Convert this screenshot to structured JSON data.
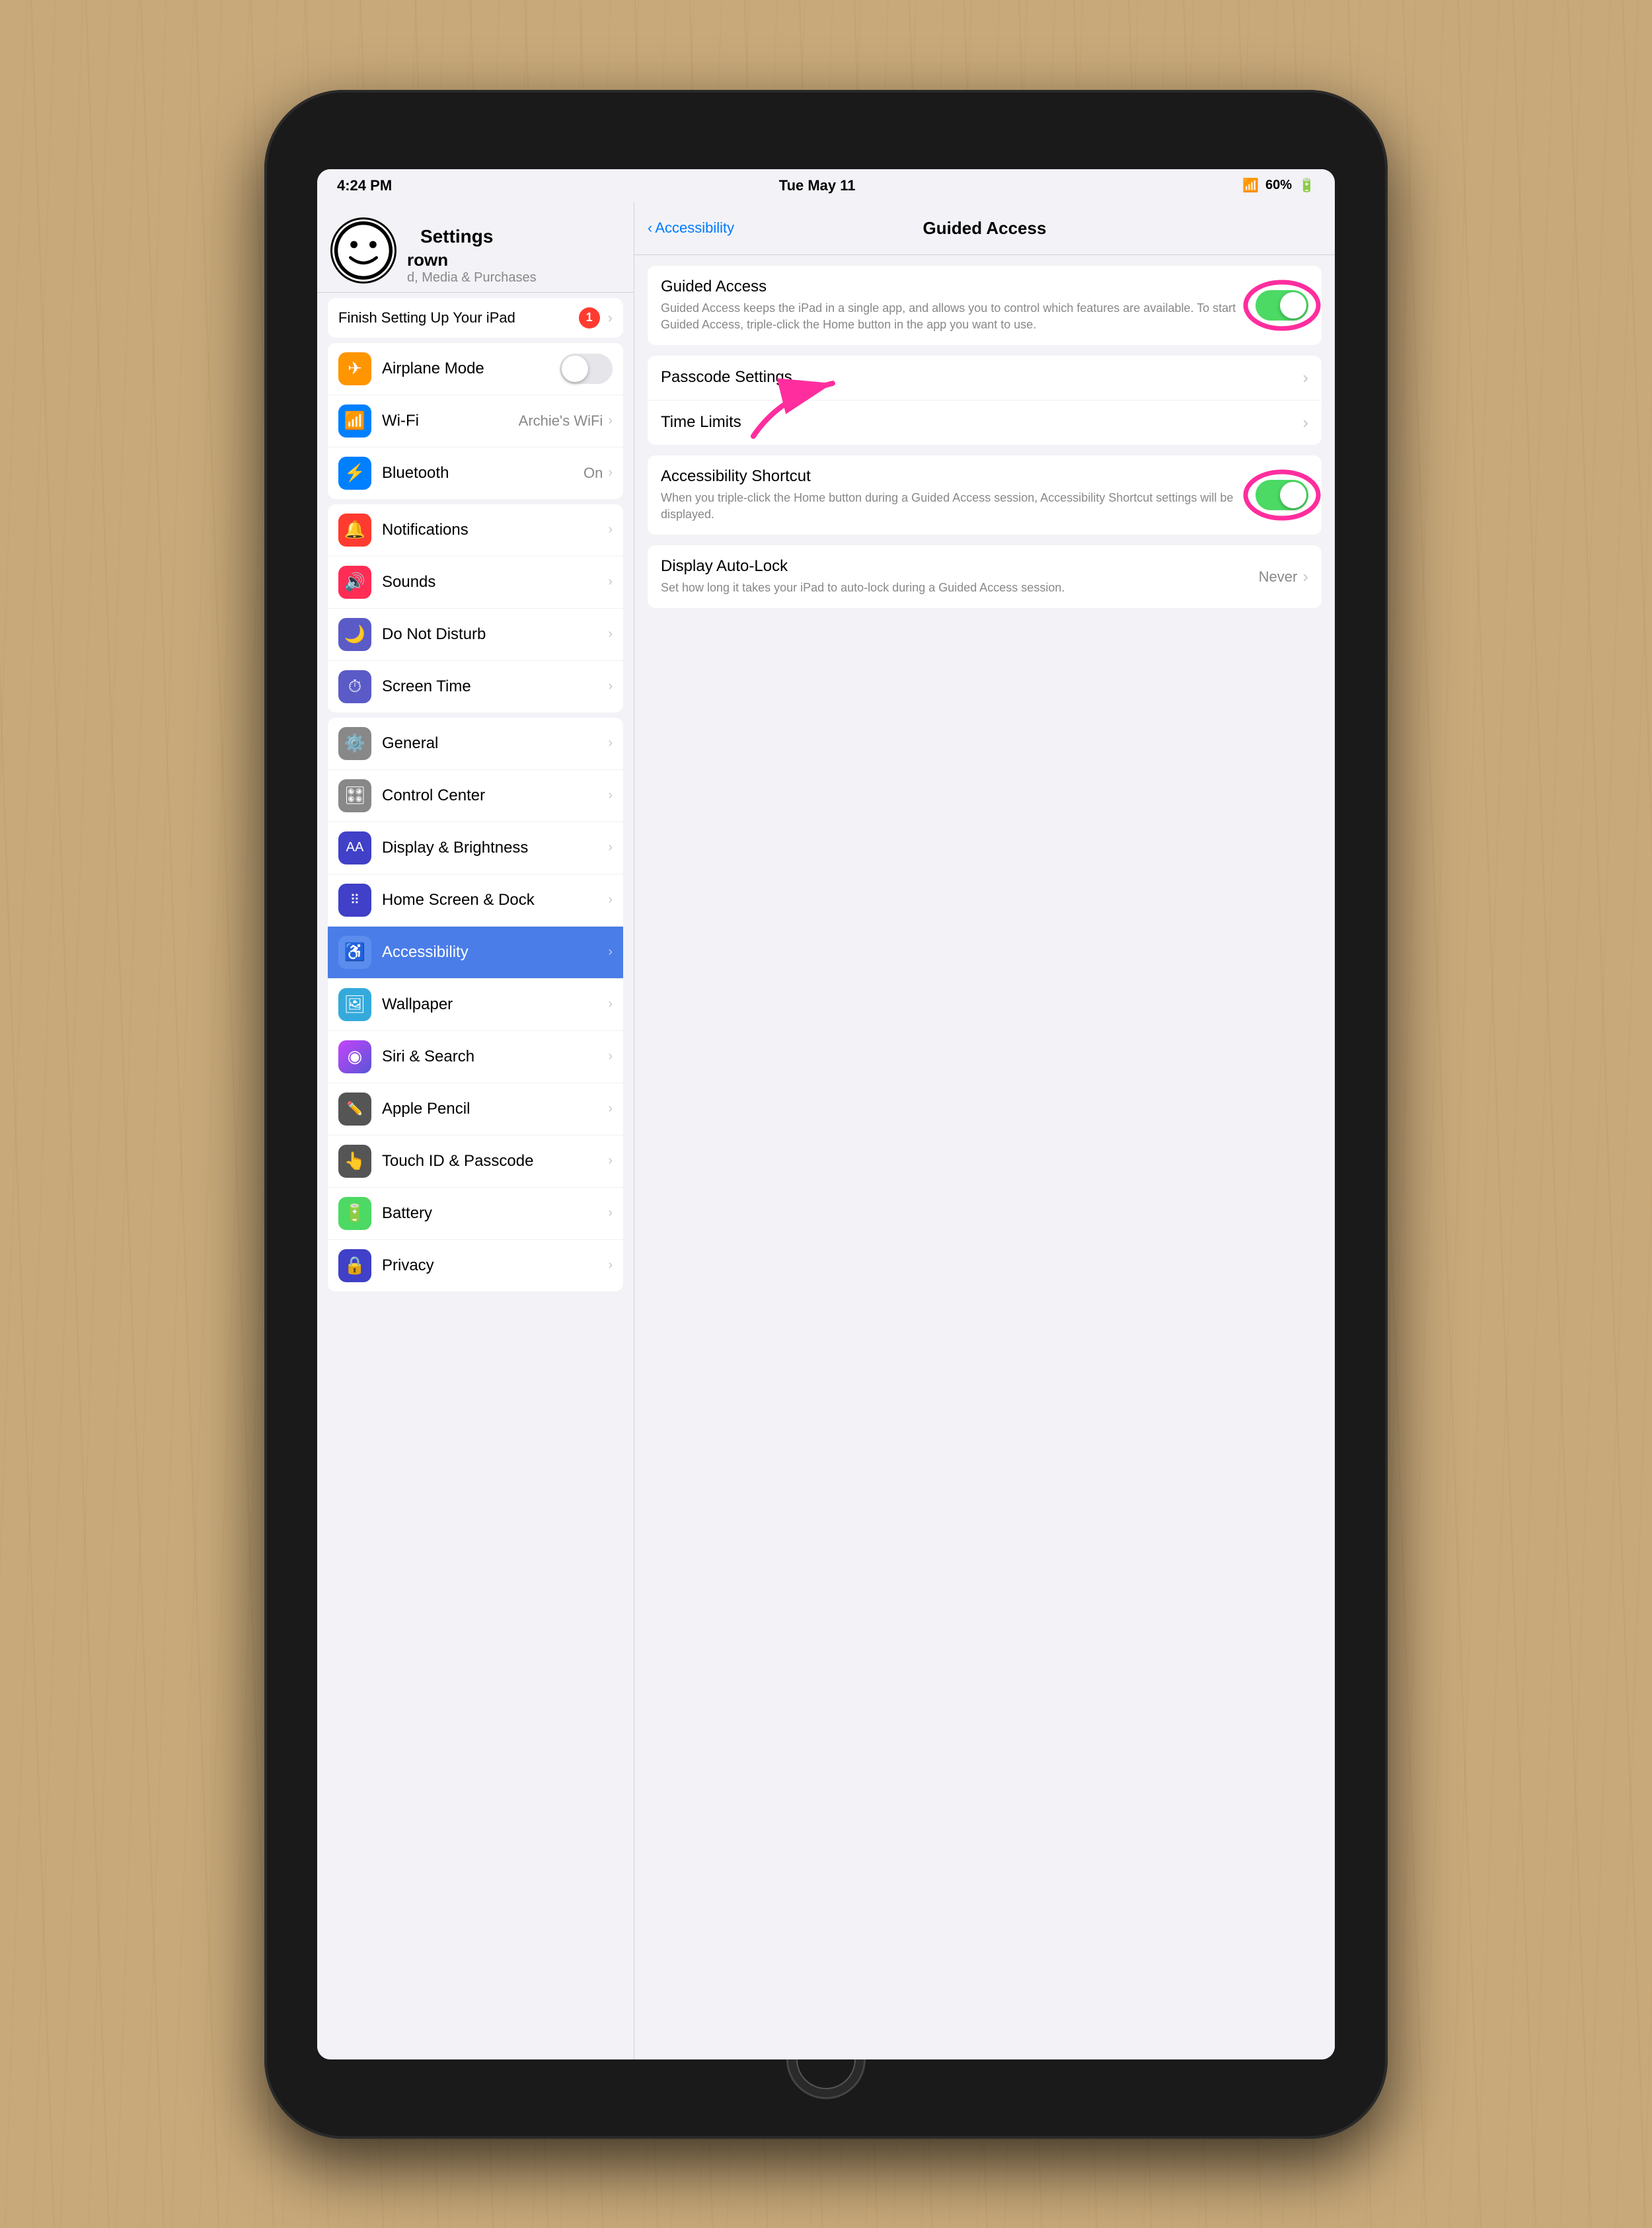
{
  "status_bar": {
    "time": "4:24 PM",
    "date": "Tue May 11",
    "battery": "60%",
    "wifi_icon": "wifi",
    "battery_icon": "battery"
  },
  "sidebar": {
    "title": "Settings",
    "profile": {
      "name": "rown",
      "subtitle": "d, Media & Purchases"
    },
    "setup_banner": {
      "text": "Finish Setting Up Your iPad",
      "badge": "1"
    },
    "groups": [
      {
        "items": [
          {
            "id": "airplane",
            "label": "Airplane Mode",
            "icon_color": "ic-airplane",
            "value": "",
            "toggle": "off",
            "has_toggle": true
          },
          {
            "id": "wifi",
            "label": "Wi-Fi",
            "icon_color": "ic-wifi",
            "value": "Archie's WiFi",
            "has_chevron": true
          },
          {
            "id": "bluetooth",
            "label": "Bluetooth",
            "icon_color": "ic-bluetooth",
            "value": "On",
            "has_chevron": true
          }
        ]
      },
      {
        "items": [
          {
            "id": "notifications",
            "label": "Notifications",
            "icon_color": "ic-notifications"
          },
          {
            "id": "sounds",
            "label": "Sounds",
            "icon_color": "ic-sounds"
          },
          {
            "id": "dnd",
            "label": "Do Not Disturb",
            "icon_color": "ic-dnd"
          },
          {
            "id": "screentime",
            "label": "Screen Time",
            "icon_color": "ic-screentime"
          }
        ]
      },
      {
        "items": [
          {
            "id": "general",
            "label": "General",
            "icon_color": "ic-general"
          },
          {
            "id": "controlcenter",
            "label": "Control Center",
            "icon_color": "ic-controlcenter"
          },
          {
            "id": "displaybright",
            "label": "Display & Brightness",
            "icon_color": "ic-displaybright"
          },
          {
            "id": "homescreen",
            "label": "Home Screen & Dock",
            "icon_color": "ic-homescreen"
          },
          {
            "id": "accessibility",
            "label": "Accessibility",
            "icon_color": "ic-accessibility",
            "active": true
          },
          {
            "id": "wallpaper",
            "label": "Wallpaper",
            "icon_color": "ic-wallpaper"
          },
          {
            "id": "siri",
            "label": "Siri & Search",
            "icon_color": "ic-siri"
          },
          {
            "id": "applepencil",
            "label": "Apple Pencil",
            "icon_color": "ic-applepencil"
          },
          {
            "id": "touchid",
            "label": "Touch ID & Passcode",
            "icon_color": "ic-touchid"
          },
          {
            "id": "battery",
            "label": "Battery",
            "icon_color": "ic-battery"
          },
          {
            "id": "privacy",
            "label": "Privacy",
            "icon_color": "ic-privacy"
          }
        ]
      }
    ]
  },
  "detail": {
    "nav_back": "Accessibility",
    "nav_title": "Guided Access",
    "sections": [
      {
        "rows": [
          {
            "id": "guided-access",
            "title": "Guided Access",
            "desc": "Guided Access keeps the iPad in a single app, and allows you to control which features are available. To start Guided Access, triple-click the Home button in the app you want to use.",
            "toggle": "on",
            "has_toggle": true
          }
        ]
      },
      {
        "rows": [
          {
            "id": "passcode-settings",
            "title": "Passcode Settings",
            "has_chevron": true
          },
          {
            "id": "time-limits",
            "title": "Time Limits",
            "has_chevron": true
          }
        ]
      },
      {
        "rows": [
          {
            "id": "accessibility-shortcut",
            "title": "Accessibility Shortcut",
            "desc": "When you triple-click the Home button during a Guided Access session, Accessibility Shortcut settings will be displayed.",
            "toggle": "on",
            "has_toggle": true
          }
        ]
      },
      {
        "rows": [
          {
            "id": "display-autolock",
            "title": "Display Auto-Lock",
            "desc": "Set how long it takes your iPad to auto-lock during a Guided Access session.",
            "value": "Never",
            "has_chevron": true
          }
        ]
      }
    ]
  }
}
